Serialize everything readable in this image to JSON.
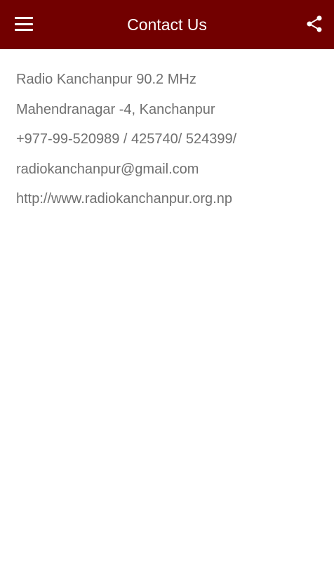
{
  "toolbar": {
    "title": "Contact Us",
    "menu_icon": "hamburger-menu-icon",
    "share_icon": "share-icon",
    "background_color": "#720000"
  },
  "contact": {
    "name": "Radio Kanchanpur 90.2 MHz",
    "address": "Mahendranagar -4, Kanchanpur",
    "phone": "+977-99-520989 / 425740/ 524399/",
    "email": "radiokanchanpur@gmail.com",
    "website": "http://www.radiokanchanpur.org.np",
    "text_color": "#707070"
  }
}
